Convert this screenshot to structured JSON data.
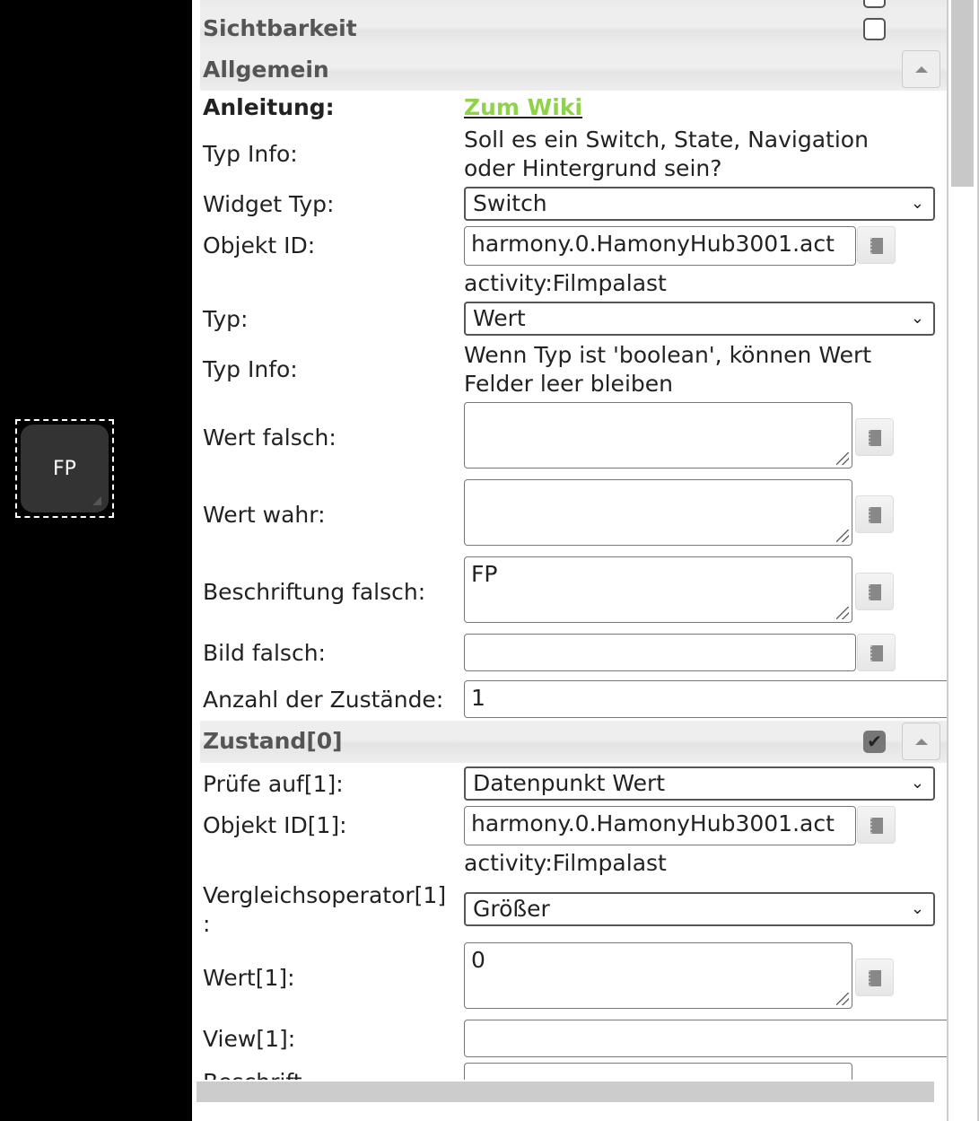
{
  "widget": {
    "label": "FP"
  },
  "sections": {
    "visibility": "Sichtbarkeit",
    "general": "Allgemein",
    "state0": "Zustand[0]"
  },
  "form": {
    "guide_label": "Anleitung:",
    "guide_link": "Zum Wiki",
    "type_info_label": "Typ Info:",
    "type_info_1": "Soll es ein Switch, State, Navigation",
    "type_info_2": "oder Hintergrund sein?",
    "widget_type_label": "Widget Typ:",
    "widget_type": "Switch",
    "object_id_label": "Objekt ID:",
    "object_id": "harmony.0.HamonyHub3001.act",
    "object_name": "activity:Filmpalast",
    "typ_label": "Typ:",
    "typ": "Wert",
    "type_info2_label": "Typ Info:",
    "type_info2_1": "Wenn Typ ist 'boolean', können Wert",
    "type_info2_2": "Felder leer bleiben",
    "value_false_label": "Wert falsch:",
    "value_false": "",
    "value_true_label": "Wert wahr:",
    "value_true": "",
    "caption_false_label": "Beschriftung falsch:",
    "caption_false": "FP",
    "image_false_label": "Bild falsch:",
    "image_false": "",
    "num_states_label": "Anzahl der Zustände:",
    "num_states": "1"
  },
  "state0": {
    "check_label": "Prüfe auf[1]:",
    "check": "Datenpunkt Wert",
    "object_id_label": "Objekt ID[1]:",
    "object_id": "harmony.0.HamonyHub3001.act",
    "object_name": "activity:Filmpalast",
    "operator_label": "Vergleichsoperator[1]",
    "operator_colon": ":",
    "operator": "Größer",
    "value_label": "Wert[1]:",
    "value": "0",
    "view_label": "View[1]:",
    "view": "",
    "caption_label": "Beschrift"
  }
}
